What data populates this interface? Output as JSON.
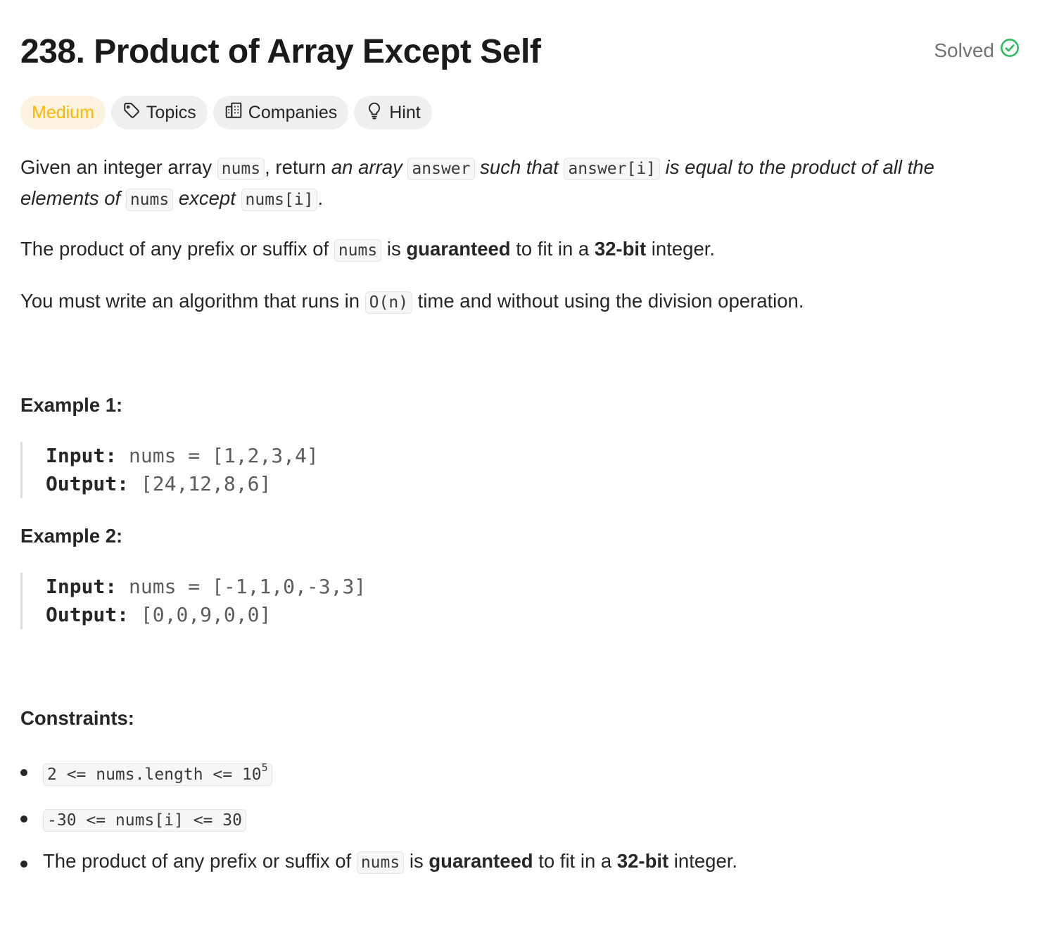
{
  "problem": {
    "title": "238. Product of Array Except Self",
    "status": "Solved"
  },
  "chips": {
    "difficulty": "Medium",
    "topics": "Topics",
    "companies": "Companies",
    "hint": "Hint"
  },
  "description": {
    "p1": {
      "t1": "Given an integer array ",
      "c1": "nums",
      "t2": ", return ",
      "e1": "an array",
      "c2": "answer",
      "e2": "such that",
      "c3": "answer[i]",
      "e3": "is equal to the product of all the",
      "e4": "elements of",
      "c4": "nums",
      "e5": "except",
      "c5": "nums[i]",
      "t3": "."
    },
    "p2": {
      "t1": "The product of any prefix or suffix of ",
      "c1": "nums",
      "t2": " is ",
      "b1": "guaranteed",
      "t3": " to fit in a ",
      "b2": "32-bit",
      "t4": " integer."
    },
    "p3": {
      "t1": "You must write an algorithm that runs in ",
      "c1": "O(n)",
      "t2": " time and without using the division operation."
    }
  },
  "examples": [
    {
      "heading": "Example 1:",
      "input_label": "Input:",
      "input_value": "nums = [1,2,3,4]",
      "output_label": "Output:",
      "output_value": "[24,12,8,6]"
    },
    {
      "heading": "Example 2:",
      "input_label": "Input:",
      "input_value": "nums = [-1,1,0,-3,3]",
      "output_label": "Output:",
      "output_value": "[0,0,9,0,0]"
    }
  ],
  "constraints": {
    "heading": "Constraints:",
    "c1": {
      "code": "2 <= nums.length <= 10",
      "sup": "5"
    },
    "c2": {
      "code": "-30 <= nums[i] <= 30"
    },
    "c3": {
      "t1": "The product of any prefix or suffix of ",
      "c1": "nums",
      "t2": " is ",
      "b1": "guaranteed",
      "t3": " to fit in a ",
      "b2": "32-bit",
      "t4": " integer."
    }
  },
  "colors": {
    "difficulty_medium": "#ffb800",
    "solved_check": "#2cbb5d"
  },
  "icons": [
    "tag-icon",
    "building-icon",
    "lightbulb-icon",
    "check-circle-icon"
  ]
}
